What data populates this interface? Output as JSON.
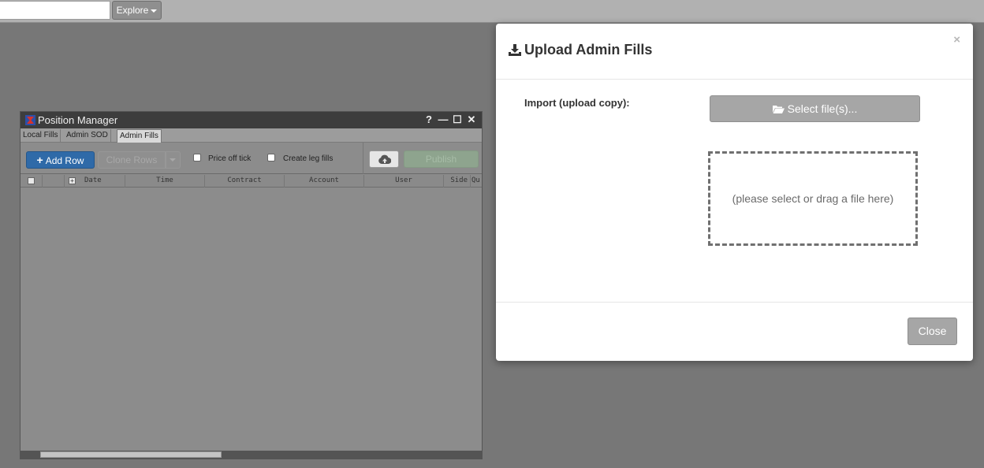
{
  "topbar": {
    "explore_label": "Explore"
  },
  "position_manager": {
    "title": "Position Manager",
    "controls": [
      "?",
      "—",
      "☐",
      "✕"
    ],
    "tabs": [
      {
        "label": "Local Fills",
        "active": false
      },
      {
        "label": "Admin SOD",
        "active": false
      },
      {
        "label": "Admin Fills",
        "active": true
      }
    ],
    "toolbar": {
      "add_row_label": "Add Row",
      "clone_rows_label": "Clone Rows",
      "price_off_tick_label": "Price off tick",
      "create_leg_fills_label": "Create leg fills",
      "publish_label": "Publish"
    },
    "columns": [
      "Date",
      "Time",
      "Contract",
      "Account",
      "User",
      "Side",
      "Qu"
    ]
  },
  "modal": {
    "title": "Upload Admin Fills",
    "close_x": "×",
    "import_label": "Import (upload copy):",
    "select_files_label": "Select file(s)...",
    "dropzone_text": "(please select or drag a file here)",
    "close_label": "Close"
  },
  "colors": {
    "background": "#777777",
    "add_row_blue": "#2f6aa8",
    "publish_green": "#8ea48e",
    "modal_button_gray": "#a6a6a6"
  }
}
